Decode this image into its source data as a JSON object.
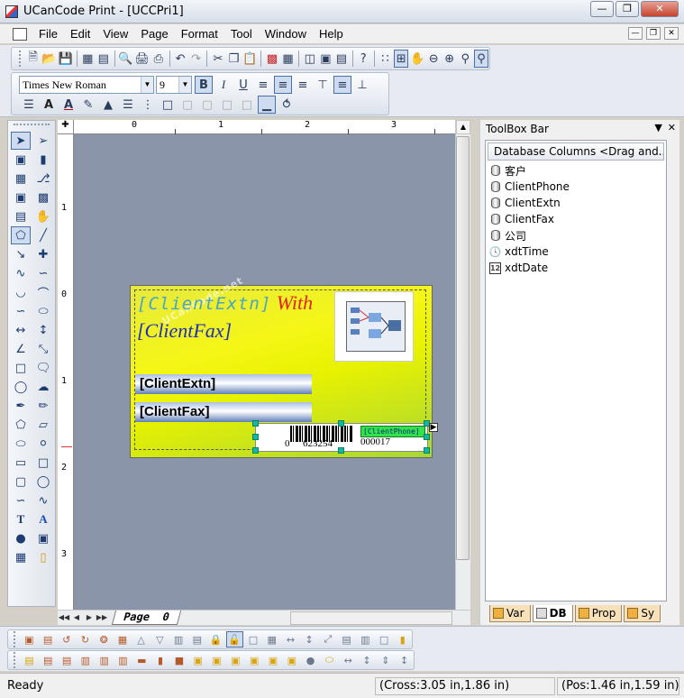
{
  "window": {
    "title": "UCanCode Print - [UCCPri1]"
  },
  "menu": [
    "File",
    "Edit",
    "View",
    "Page",
    "Format",
    "Tool",
    "Window",
    "Help"
  ],
  "format_bar": {
    "font_name": "Times New Roman",
    "font_size": "9"
  },
  "rulers": {
    "h_labels": [
      "0",
      "1",
      "2",
      "3"
    ],
    "v_labels": [
      "1",
      "0",
      "1",
      "2",
      "3"
    ]
  },
  "card": {
    "title_field": "[ClientExtn]",
    "title_with": "With",
    "title_line2": "[ClientFax]",
    "watermark": "UCanCode.net",
    "bar1": "[ClientExtn]",
    "bar2": "[ClientFax]",
    "barcode_left": "0",
    "barcode_mid": "623254",
    "barcode_right": "000017",
    "barcode_tag": "[ClientPhone]"
  },
  "page_tab": "Page  0",
  "toolbox": {
    "title": "ToolBox Bar",
    "column_header": "Database Columns <Drag and...",
    "items": [
      {
        "icon": "database-icon",
        "label": "客户"
      },
      {
        "icon": "database-icon",
        "label": "ClientPhone"
      },
      {
        "icon": "database-icon",
        "label": "ClientExtn"
      },
      {
        "icon": "database-icon",
        "label": "ClientFax"
      },
      {
        "icon": "database-icon",
        "label": "公司"
      },
      {
        "icon": "clock-icon",
        "label": "xdtTime"
      },
      {
        "icon": "calendar-icon",
        "label": "xdtDate"
      }
    ],
    "tabs": [
      "Var",
      "DB",
      "Prop",
      "Sy"
    ],
    "active_tab": "DB"
  },
  "status": {
    "ready": "Ready",
    "cross": "(Cross:3.05 in,1.86 in)",
    "pos": "(Pos:1.46 in,1.59 in)"
  },
  "colors": {
    "accent": "#4a6fa5",
    "design_bg": "#8a95aa",
    "card_yellow": "#f5f616"
  }
}
